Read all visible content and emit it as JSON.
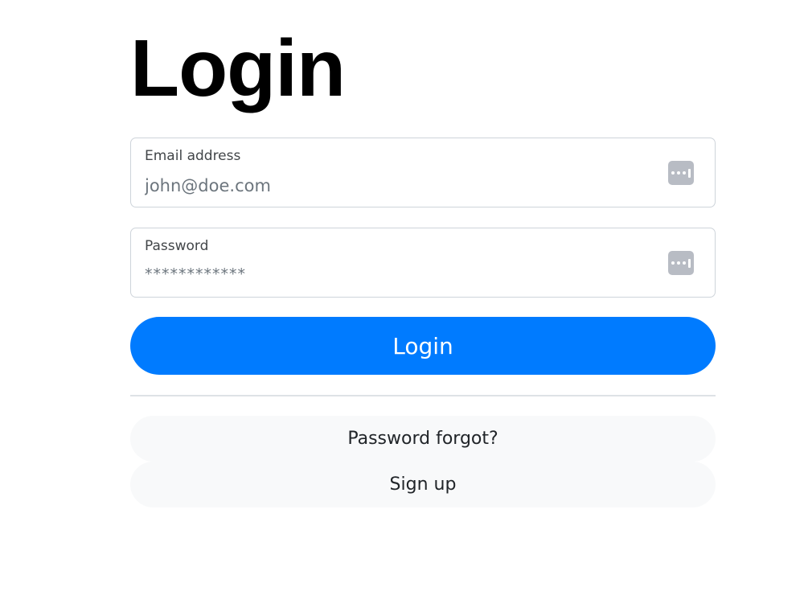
{
  "page": {
    "title": "Login"
  },
  "email": {
    "label": "Email address",
    "placeholder": "john@doe.com",
    "value": ""
  },
  "password": {
    "label": "Password",
    "placeholder": "************",
    "value": ""
  },
  "actions": {
    "login_label": "Login",
    "forgot_label": "Password forgot?",
    "signup_label": "Sign up"
  },
  "icons": {
    "autofill": "password-manager-key-icon"
  },
  "colors": {
    "primary": "#007bff",
    "secondary_bg": "#f8f9fa",
    "border": "#ced4da",
    "icon": "#b8bcc4"
  }
}
